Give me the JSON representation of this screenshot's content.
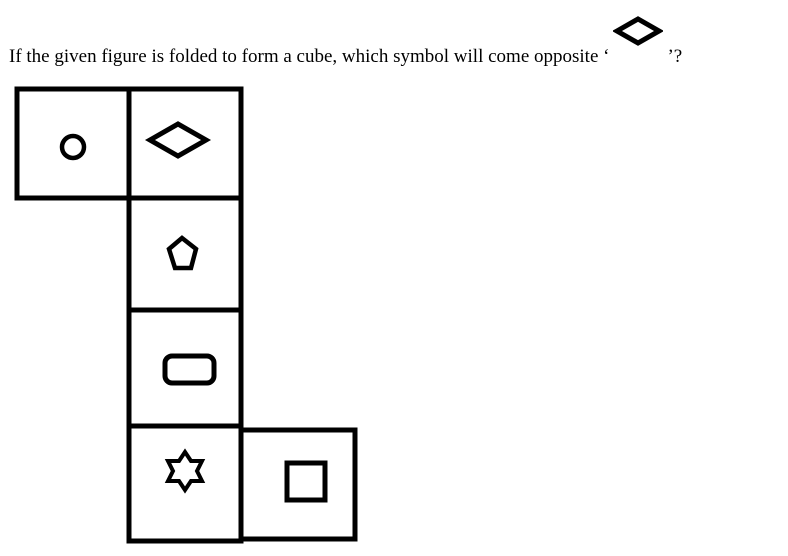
{
  "question": {
    "before": "If the given figure is folded to form a cube, which symbol will come opposite ‘",
    "after": "’?",
    "symbol_icon": "diamond-icon"
  },
  "net": {
    "stroke_color": "#000000",
    "faces": [
      {
        "col": 0,
        "row": 0,
        "symbol": "circle"
      },
      {
        "col": 1,
        "row": 0,
        "symbol": "diamond"
      },
      {
        "col": 1,
        "row": 1,
        "symbol": "pentagon"
      },
      {
        "col": 1,
        "row": 2,
        "symbol": "rounded-rectangle"
      },
      {
        "col": 1,
        "row": 3,
        "symbol": "six-pointed-star"
      },
      {
        "col": 2,
        "row": 3,
        "symbol": "square"
      }
    ]
  }
}
